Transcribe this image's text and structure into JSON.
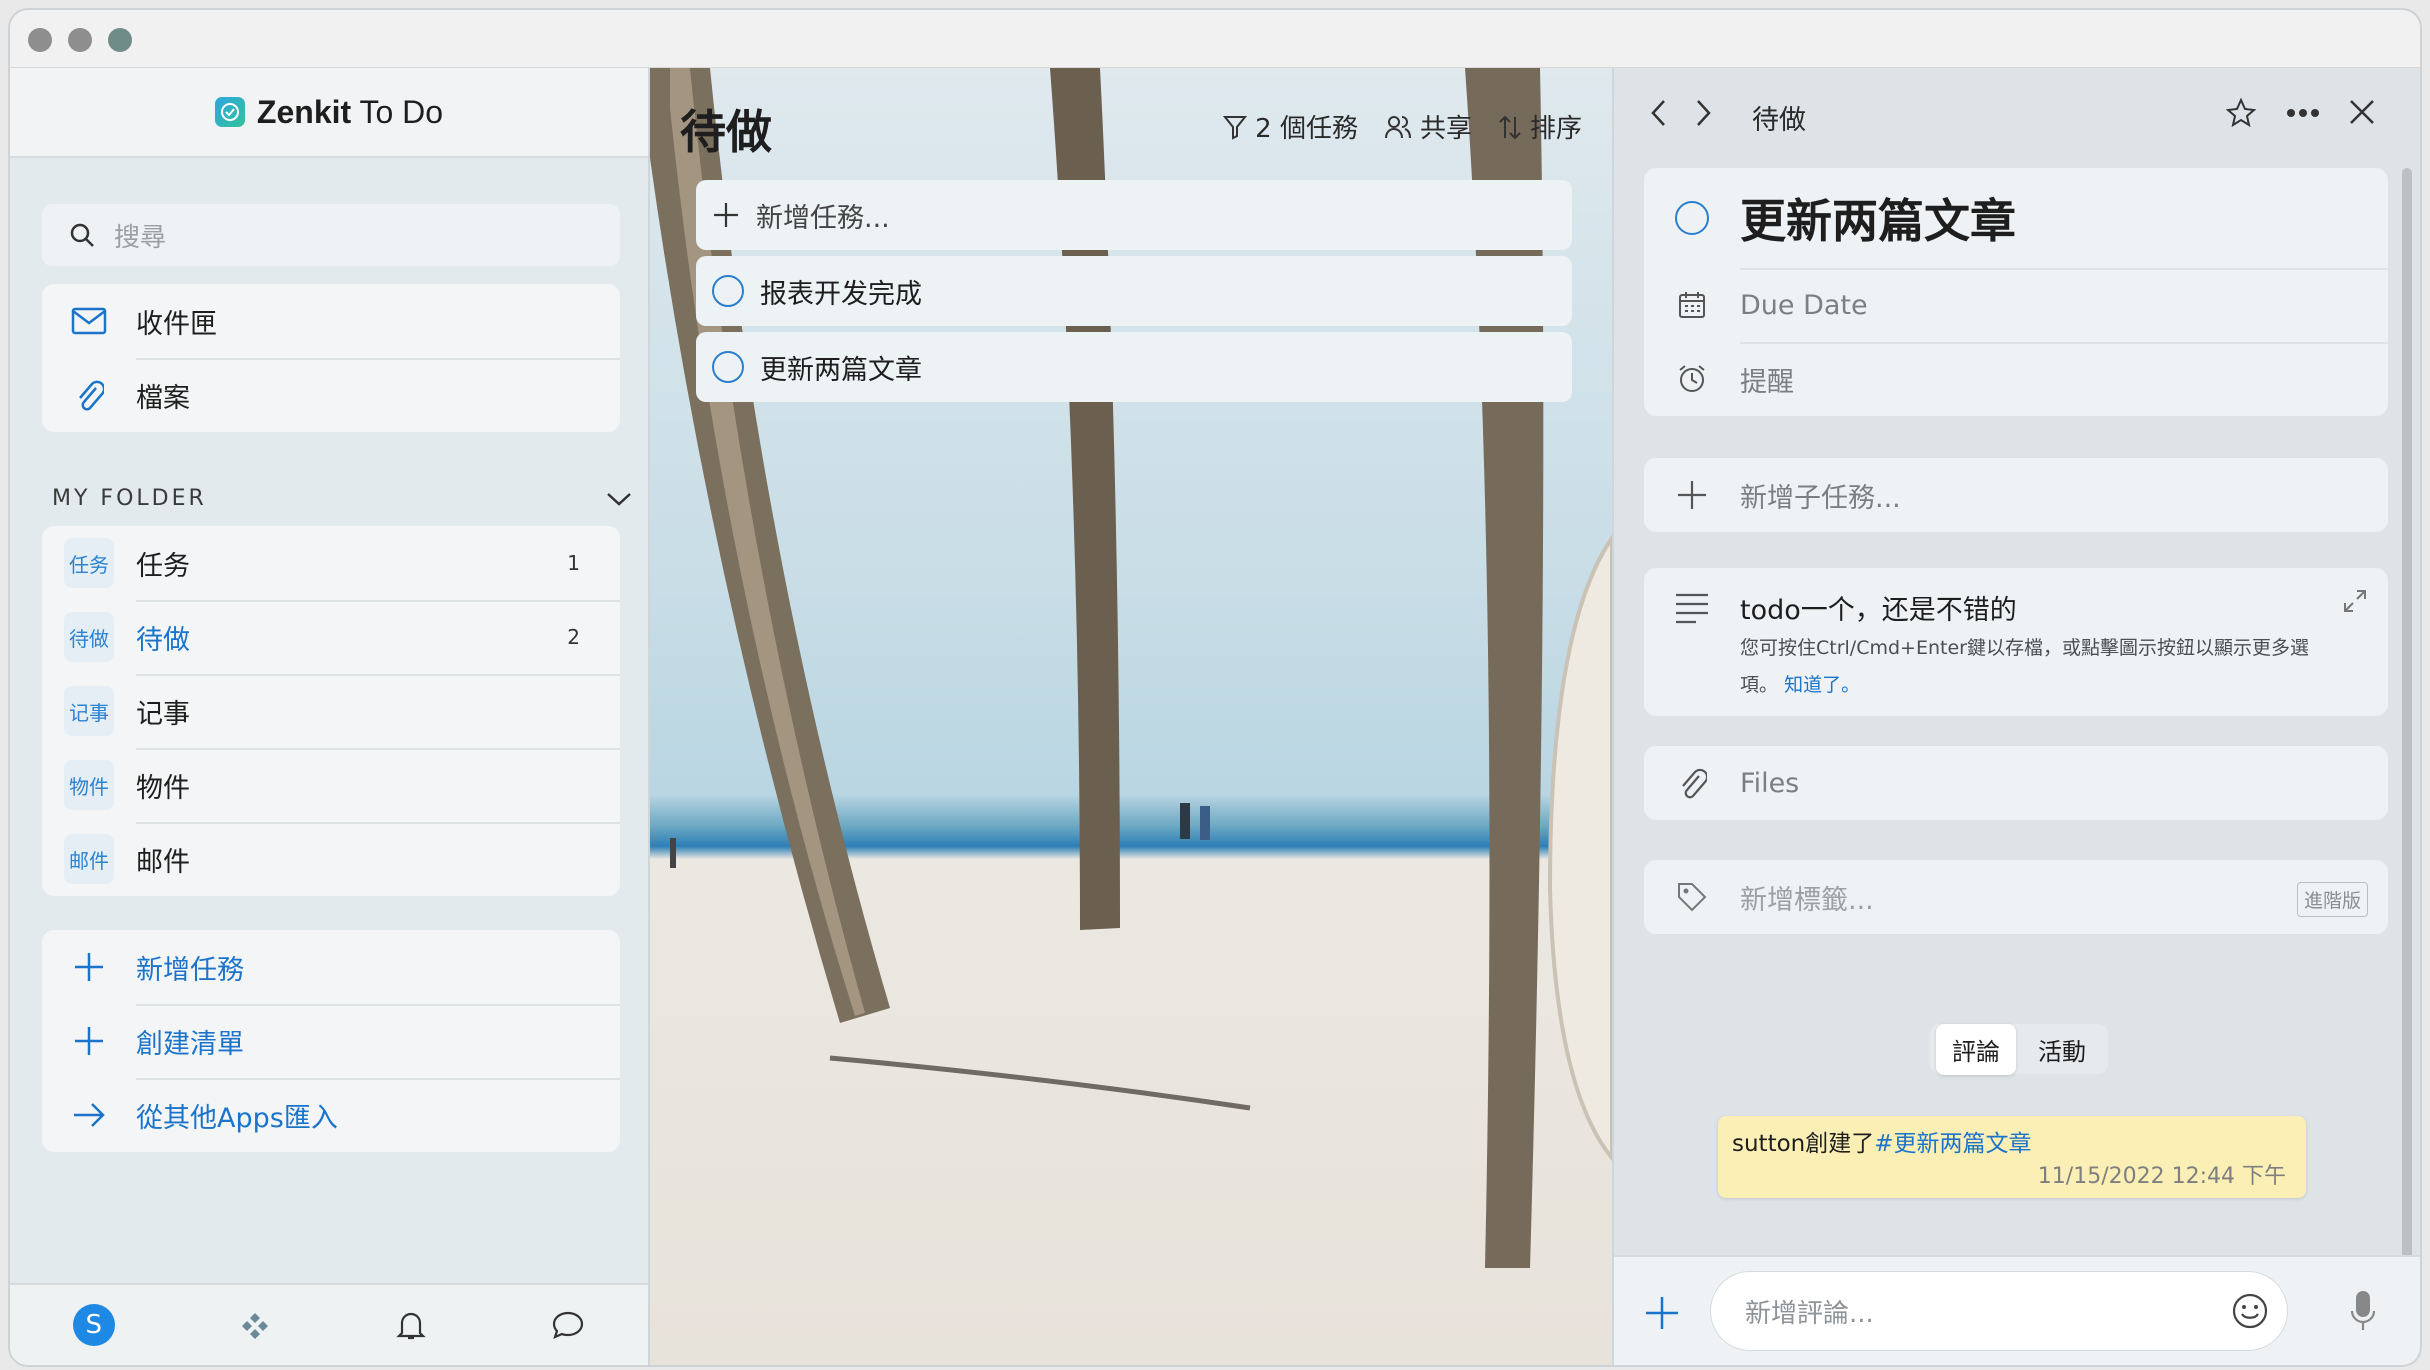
{
  "app": {
    "name_bold": "Zenkit",
    "name_rest": " To Do"
  },
  "search": {
    "placeholder": "搜尋"
  },
  "quick_items": [
    {
      "label": "收件匣",
      "icon": "envelope-icon"
    },
    {
      "label": "檔案",
      "icon": "paperclip-icon"
    }
  ],
  "folder": {
    "title": "MY FOLDER",
    "lists": [
      {
        "tag": "任务",
        "label": "任务",
        "count": "1"
      },
      {
        "tag": "待做",
        "label": "待做",
        "count": "2",
        "selected": true
      },
      {
        "tag": "记事",
        "label": "记事",
        "count": ""
      },
      {
        "tag": "物件",
        "label": "物件",
        "count": ""
      },
      {
        "tag": "邮件",
        "label": "邮件",
        "count": ""
      }
    ]
  },
  "actions": [
    {
      "label": "新增任務",
      "icon": "plus-icon"
    },
    {
      "label": "創建清單",
      "icon": "plus-icon"
    },
    {
      "label": "從其他Apps匯入",
      "icon": "arrow-right-icon"
    }
  ],
  "footer": {
    "avatar_letter": "S"
  },
  "list_view": {
    "title": "待做",
    "filter_label": "2 個任務",
    "share_label": "共享",
    "sort_label": "排序",
    "add_task_placeholder": "新增任務...",
    "tasks": [
      {
        "title": "报表开发完成"
      },
      {
        "title": "更新两篇文章"
      }
    ]
  },
  "detail": {
    "breadcrumb": "待做",
    "task_title": "更新两篇文章",
    "due_date_label": "Due Date",
    "reminder_label": "提醒",
    "add_subtask_placeholder": "新增子任務...",
    "note_text": "todo一个，还是不错的",
    "note_hint": "您可按住Ctrl/Cmd+Enter鍵以存檔，或點擊圖示按鈕以顯示更多選項。",
    "note_hint_link": "知道了。",
    "files_label": "Files",
    "add_tag_placeholder": "新增標籤...",
    "pro_badge": "進階版",
    "tabs": [
      "評論",
      "活動"
    ],
    "comment": {
      "author_text": "sutton創建了",
      "link_text": "#更新两篇文章",
      "timestamp": "11/15/2022 12:44 下午"
    },
    "comment_placeholder": "新增評論..."
  },
  "colors": {
    "accent": "#1b74c9",
    "comment_bg": "#fbefb6",
    "checkbox": "#2b7fcc"
  }
}
